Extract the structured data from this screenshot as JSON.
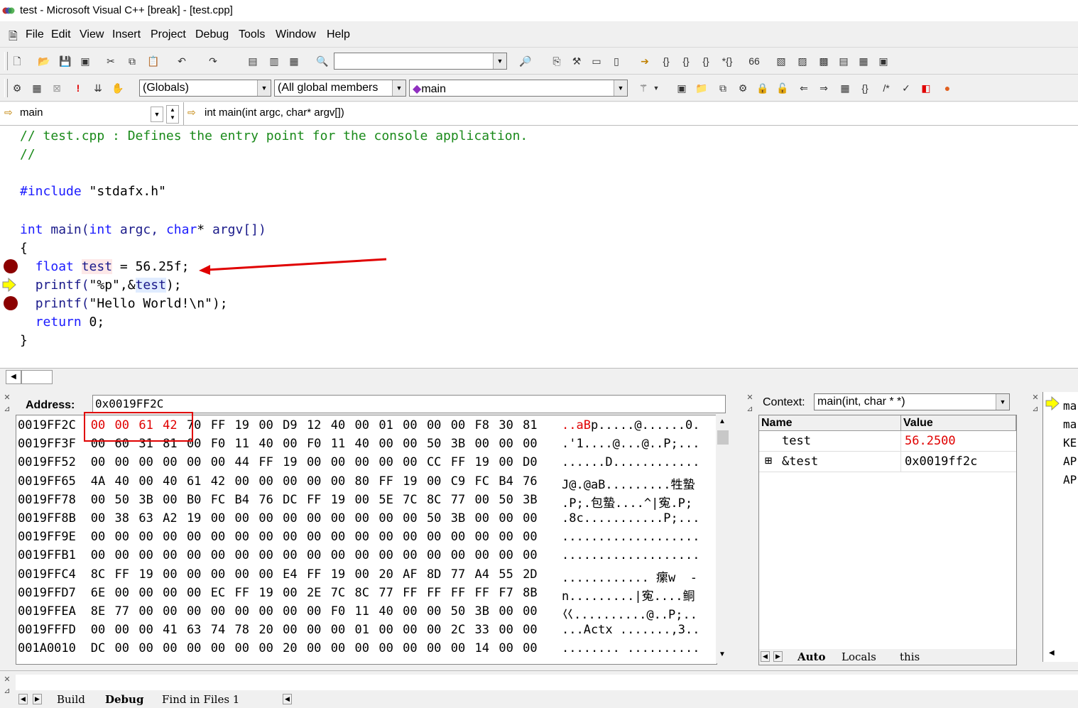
{
  "window": {
    "title": "test - Microsoft Visual C++ [break] - [test.cpp]"
  },
  "menu": [
    "File",
    "Edit",
    "View",
    "Insert",
    "Project",
    "Debug",
    "Tools",
    "Window",
    "Help"
  ],
  "toolbar": {
    "find_combo_value": "",
    "globals_combo": "(Globals)",
    "members_combo": "(All global members",
    "function_combo": "main",
    "context_combo": "main",
    "context_signature": "int main(int argc, char* argv[])"
  },
  "editor": {
    "lines": [
      "// test.cpp : Defines the entry point for the console application.",
      "//",
      "",
      "#include \"stdafx.h\"",
      "",
      "int main(int argc, char* argv[])",
      "{",
      "    float test = 56.25f;",
      "    printf(\"%p\",&test);",
      "    printf(\"Hello World!\\n\");",
      "    return 0;",
      "}"
    ]
  },
  "memory": {
    "address_label": "Address:",
    "address_value": "0x0019FF2C",
    "rows": [
      {
        "addr": "0019FF2C",
        "bytes": [
          "00",
          "00",
          "61",
          "42",
          "70",
          "FF",
          "19",
          "00",
          "D9",
          "12",
          "40",
          "00",
          "01",
          "00",
          "00",
          "00",
          "F8",
          "30",
          "81"
        ],
        "ascii": "..aBp.....@......0."
      },
      {
        "addr": "0019FF3F",
        "bytes": [
          "00",
          "60",
          "31",
          "81",
          "00",
          "F0",
          "11",
          "40",
          "00",
          "F0",
          "11",
          "40",
          "00",
          "00",
          "50",
          "3B",
          "00",
          "00",
          "00"
        ],
        "ascii": ".'1....@...@..P;..."
      },
      {
        "addr": "0019FF52",
        "bytes": [
          "00",
          "00",
          "00",
          "00",
          "00",
          "00",
          "44",
          "FF",
          "19",
          "00",
          "00",
          "00",
          "00",
          "00",
          "CC",
          "FF",
          "19",
          "00",
          "D0"
        ],
        "ascii": "......D............"
      },
      {
        "addr": "0019FF65",
        "bytes": [
          "4A",
          "40",
          "00",
          "40",
          "61",
          "42",
          "00",
          "00",
          "00",
          "00",
          "00",
          "80",
          "FF",
          "19",
          "00",
          "C9",
          "FC",
          "B4",
          "76"
        ],
        "ascii": "J@.@aB.........牲蟄"
      },
      {
        "addr": "0019FF78",
        "bytes": [
          "00",
          "50",
          "3B",
          "00",
          "B0",
          "FC",
          "B4",
          "76",
          "DC",
          "FF",
          "19",
          "00",
          "5E",
          "7C",
          "8C",
          "77",
          "00",
          "50",
          "3B"
        ],
        "ascii": ".P;.包蟄....^|寃.P;"
      },
      {
        "addr": "0019FF8B",
        "bytes": [
          "00",
          "38",
          "63",
          "A2",
          "19",
          "00",
          "00",
          "00",
          "00",
          "00",
          "00",
          "00",
          "00",
          "00",
          "50",
          "3B",
          "00",
          "00",
          "00"
        ],
        "ascii": ".8c...........P;..."
      },
      {
        "addr": "0019FF9E",
        "bytes": [
          "00",
          "00",
          "00",
          "00",
          "00",
          "00",
          "00",
          "00",
          "00",
          "00",
          "00",
          "00",
          "00",
          "00",
          "00",
          "00",
          "00",
          "00",
          "00"
        ],
        "ascii": "..................."
      },
      {
        "addr": "0019FFB1",
        "bytes": [
          "00",
          "00",
          "00",
          "00",
          "00",
          "00",
          "00",
          "00",
          "00",
          "00",
          "00",
          "00",
          "00",
          "00",
          "00",
          "00",
          "00",
          "00",
          "00"
        ],
        "ascii": "..................."
      },
      {
        "addr": "0019FFC4",
        "bytes": [
          "8C",
          "FF",
          "19",
          "00",
          "00",
          "00",
          "00",
          "00",
          "E4",
          "FF",
          "19",
          "00",
          "20",
          "AF",
          "8D",
          "77",
          "A4",
          "55",
          "2D"
        ],
        "ascii": "............ 瘰w  -"
      },
      {
        "addr": "0019FFD7",
        "bytes": [
          "6E",
          "00",
          "00",
          "00",
          "00",
          "EC",
          "FF",
          "19",
          "00",
          "2E",
          "7C",
          "8C",
          "77",
          "FF",
          "FF",
          "FF",
          "FF",
          "F7",
          "8B"
        ],
        "ascii": "n.........|寃....鲖"
      },
      {
        "addr": "0019FFEA",
        "bytes": [
          "8E",
          "77",
          "00",
          "00",
          "00",
          "00",
          "00",
          "00",
          "00",
          "00",
          "F0",
          "11",
          "40",
          "00",
          "00",
          "50",
          "3B",
          "00",
          "00"
        ],
        "ascii": "巜..........@..P;.."
      },
      {
        "addr": "0019FFFD",
        "bytes": [
          "00",
          "00",
          "00",
          "41",
          "63",
          "74",
          "78",
          "20",
          "00",
          "00",
          "00",
          "01",
          "00",
          "00",
          "00",
          "2C",
          "33",
          "00",
          "00"
        ],
        "ascii": "...Actx .......,3.."
      },
      {
        "addr": "001A0010",
        "bytes": [
          "DC",
          "00",
          "00",
          "00",
          "00",
          "00",
          "00",
          "00",
          "20",
          "00",
          "00",
          "00",
          "00",
          "00",
          "00",
          "00",
          "14",
          "00",
          "00"
        ],
        "ascii": "........ .........."
      }
    ]
  },
  "variables": {
    "context_label": "Context:",
    "context_value": "main(int, char * *)",
    "col_name": "Name",
    "col_value": "Value",
    "rows": [
      {
        "expand": "",
        "name": "test",
        "value": "56.2500",
        "changed": true
      },
      {
        "expand": "⊞",
        "name": "&test",
        "value": "0x0019ff2c",
        "changed": false
      }
    ],
    "tabs": [
      "Auto",
      "Locals",
      "this"
    ]
  },
  "callstack": {
    "items": [
      "ma",
      "ma",
      "KE",
      "AP",
      "AP"
    ]
  },
  "output": {
    "tabs": [
      "Build",
      "Debug",
      "Find in Files 1"
    ]
  },
  "colors": {
    "comment": "#1a8a1a",
    "keyword": "#1a1aff",
    "breakpoint": "#8b0000",
    "changed_value": "#e00000",
    "highlight_box": "#e00000",
    "arrow": "#e00000"
  }
}
